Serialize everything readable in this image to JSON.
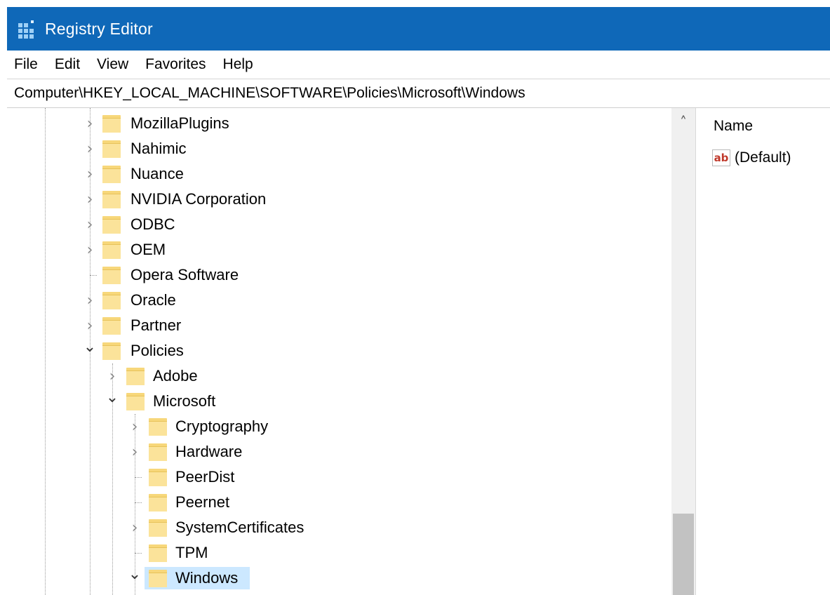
{
  "window": {
    "title": "Registry Editor",
    "accent": "#0f68b8"
  },
  "menu": [
    "File",
    "Edit",
    "View",
    "Favorites",
    "Help"
  ],
  "address": "Computer\\HKEY_LOCAL_MACHINE\\SOFTWARE\\Policies\\Microsoft\\Windows",
  "tree": [
    {
      "label": "MozillaPlugins",
      "level": 0,
      "state": "collapsed"
    },
    {
      "label": "Nahimic",
      "level": 0,
      "state": "collapsed"
    },
    {
      "label": "Nuance",
      "level": 0,
      "state": "collapsed"
    },
    {
      "label": "NVIDIA Corporation",
      "level": 0,
      "state": "collapsed"
    },
    {
      "label": "ODBC",
      "level": 0,
      "state": "collapsed"
    },
    {
      "label": "OEM",
      "level": 0,
      "state": "collapsed"
    },
    {
      "label": "Opera Software",
      "level": 0,
      "state": "leaf"
    },
    {
      "label": "Oracle",
      "level": 0,
      "state": "collapsed"
    },
    {
      "label": "Partner",
      "level": 0,
      "state": "collapsed"
    },
    {
      "label": "Policies",
      "level": 0,
      "state": "expanded"
    },
    {
      "label": "Adobe",
      "level": 1,
      "state": "collapsed"
    },
    {
      "label": "Microsoft",
      "level": 1,
      "state": "expanded"
    },
    {
      "label": "Cryptography",
      "level": 2,
      "state": "collapsed"
    },
    {
      "label": "Hardware",
      "level": 2,
      "state": "collapsed"
    },
    {
      "label": "PeerDist",
      "level": 2,
      "state": "leaf"
    },
    {
      "label": "Peernet",
      "level": 2,
      "state": "leaf"
    },
    {
      "label": "SystemCertificates",
      "level": 2,
      "state": "collapsed"
    },
    {
      "label": "TPM",
      "level": 2,
      "state": "leaf"
    },
    {
      "label": "Windows",
      "level": 2,
      "state": "expanded",
      "selected": true
    }
  ],
  "values_pane": {
    "column_name": "Name",
    "entries": [
      {
        "name": "(Default)",
        "icon": "reg-sz-ab-icon"
      }
    ]
  },
  "colors": {
    "selection": "#cce8ff",
    "folder": "#f7d77a"
  }
}
